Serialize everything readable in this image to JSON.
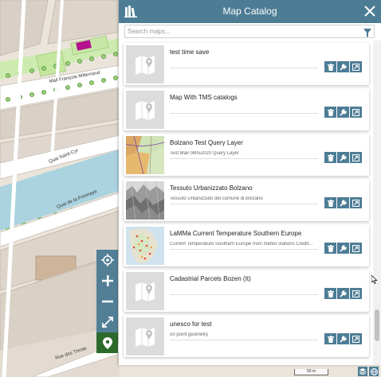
{
  "panel": {
    "title": "Map Catalog",
    "search_placeholder": "Search maps...",
    "catalog_icon": "catalog-icon",
    "close_icon": "close-icon",
    "filter_icon": "filter-icon"
  },
  "maps": [
    {
      "title": "test time save",
      "description": "",
      "thumb": "placeholder"
    },
    {
      "title": "Map With TMS catalogs",
      "description": "",
      "thumb": "placeholder"
    },
    {
      "title": "Bolzano Test Query Layer",
      "description": "Test Mail 08052020 Query Layer",
      "thumb": "map-image"
    },
    {
      "title": "Tessuto Urbanizzato Bolzano",
      "description": "Tessuto Urbanizzato del comune di Bolzano",
      "thumb": "terrain-image"
    },
    {
      "title": "LaMMa Current Temperature Southern Europe",
      "description": "Current Temperature Southern Europe from meteo stations Credit...",
      "thumb": "map-image"
    },
    {
      "title": "Cadastrial Parcels Bozen (It)",
      "description": "",
      "thumb": "placeholder"
    },
    {
      "title": "unesco for test",
      "description": "on point geometry",
      "thumb": "placeholder"
    }
  ],
  "card_actions": [
    "delete-icon",
    "wrench-icon",
    "share-icon"
  ],
  "map": {
    "street_labels": [
      "Mail François Mitterrand",
      "Quai Saint-Cyr",
      "Quai de la Fresnaye",
      "Rue des Trente"
    ],
    "controls": [
      "locate-icon",
      "zoom-in-icon",
      "zoom-out-icon",
      "fullscreen-icon",
      "pin-icon"
    ],
    "scale": "50 m"
  },
  "colors": {
    "header": "#4d7d95",
    "button": "#527f96",
    "active_button": "#2d6b2d"
  }
}
